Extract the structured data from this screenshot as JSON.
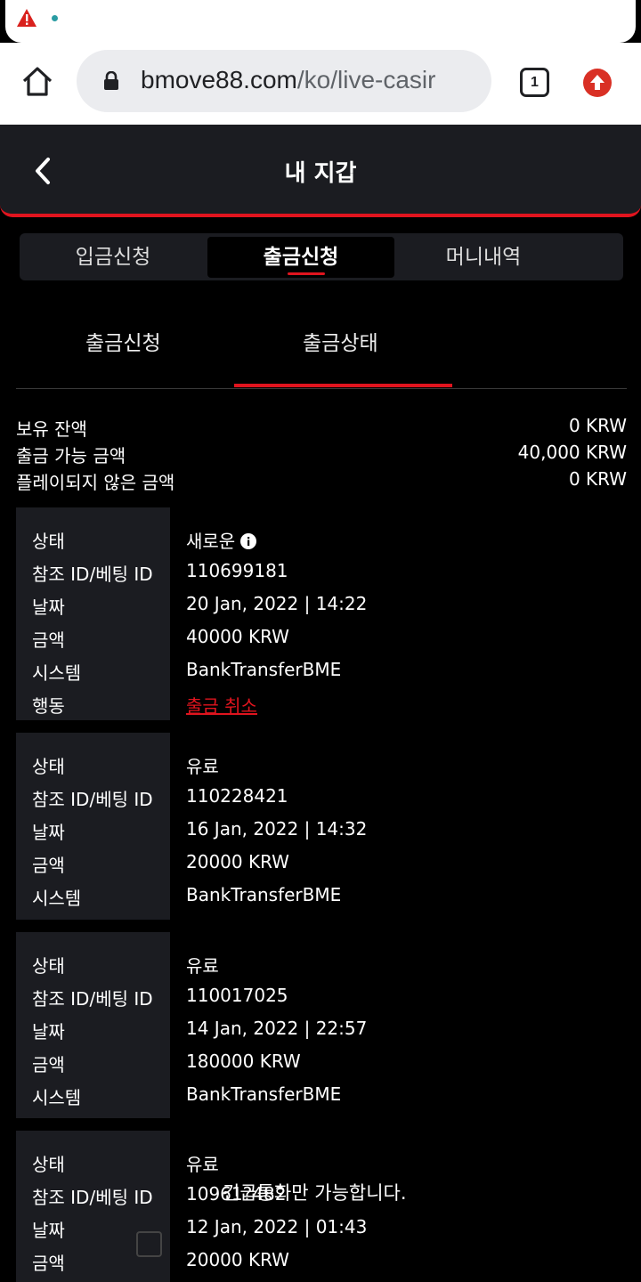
{
  "browser": {
    "url_host": "bmove88.com",
    "url_path": "/ko/live-casir",
    "tab_count": "1"
  },
  "header": {
    "title": "내 지갑"
  },
  "segments": [
    "입금신청",
    "출금신청",
    "머니내역"
  ],
  "subtabs": [
    "출금신청",
    "출금상태"
  ],
  "balances": [
    {
      "label": "보유 잔액",
      "value": "0 KRW"
    },
    {
      "label": "출금 가능 금액",
      "value": "40,000 KRW"
    },
    {
      "label": "플레이되지 않은 금액",
      "value": "0 KRW"
    }
  ],
  "field_labels": {
    "status": "상태",
    "ref": "참조 ID/베팅 ID",
    "date": "날짜",
    "amount": "금액",
    "system": "시스템",
    "action": "행동"
  },
  "transactions": [
    {
      "status": "새로운",
      "ref": "110699181",
      "date": "20 Jan, 2022 | 14:22",
      "amount": "40000 KRW",
      "system": "BankTransferBME",
      "action": "출금 취소"
    },
    {
      "status": "유료",
      "ref": "110228421",
      "date": "16 Jan, 2022 | 14:32",
      "amount": "20000 KRW",
      "system": "BankTransferBME"
    },
    {
      "status": "유료",
      "ref": "110017025",
      "date": "14 Jan, 2022 | 22:57",
      "amount": "180000 KRW",
      "system": "BankTransferBME"
    },
    {
      "status": "유료",
      "ref": "10961?482",
      "date": "12 Jan, 2022 | 01:43",
      "amount": "20000 KRW"
    }
  ],
  "toast": "긴급통화만 가능합니다.",
  "colors": {
    "accent": "#e0141e",
    "panel": "#1b1c21",
    "background": "#000000"
  }
}
